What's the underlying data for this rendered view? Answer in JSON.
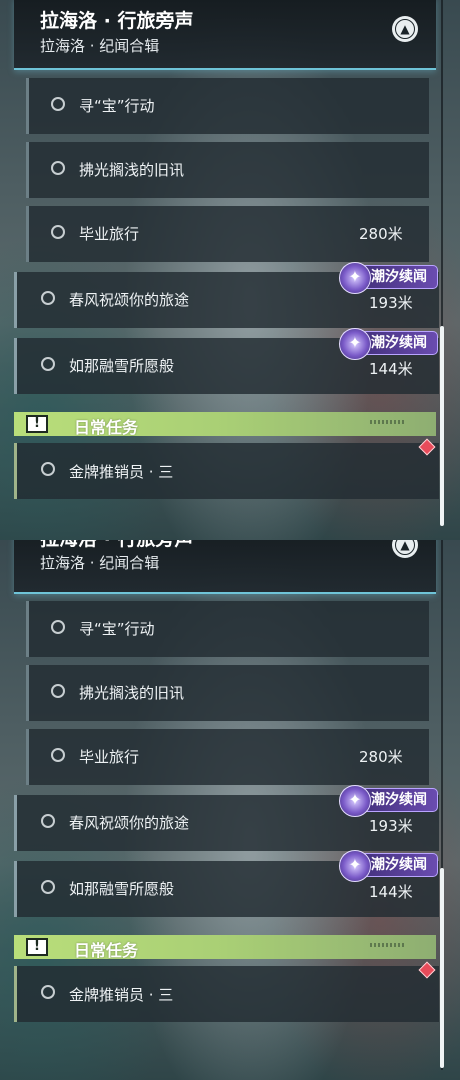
{
  "header": {
    "title": "拉海洛 · 行旅旁声",
    "subtitle": "拉海洛 · 纪闻合辑",
    "collapse_icon": "chevron-up-icon"
  },
  "quests": [
    {
      "name": "寻“宝”行动",
      "distance": ""
    },
    {
      "name": "拂光搁浅的旧讯",
      "distance": ""
    },
    {
      "name": "毕业旅行",
      "distance": "280米"
    },
    {
      "name": "春风祝颂你的旅途",
      "distance": "193米",
      "badge": "潮汐续闻"
    },
    {
      "name": "如那融雪所愿般",
      "distance": "144米",
      "badge": "潮汐续闻"
    }
  ],
  "daily_section": {
    "label": "日常任务",
    "icon": "exclamation-icon",
    "quests": [
      {
        "name": "金牌推销员 · 三",
        "tracked_icon": "diamond-marker-icon"
      }
    ]
  },
  "colors": {
    "header_accent": "#6fc4d8",
    "daily_accent": "#b9de7a",
    "badge_purple": "#6a4cb0",
    "tracked_red": "#e84b5a"
  }
}
